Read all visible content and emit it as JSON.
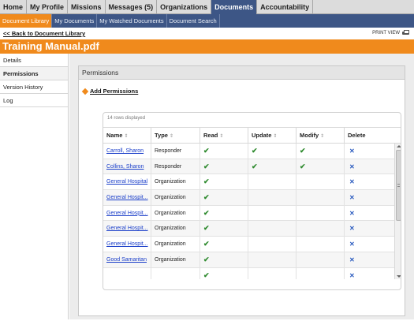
{
  "top_nav": [
    {
      "label": "Home",
      "active": false
    },
    {
      "label": "My Profile",
      "active": false
    },
    {
      "label": "Missions",
      "active": false
    },
    {
      "label": "Messages (5)",
      "active": false
    },
    {
      "label": "Organizations",
      "active": false
    },
    {
      "label": "Documents",
      "active": true
    },
    {
      "label": "Accountability",
      "active": false
    }
  ],
  "sub_nav": [
    {
      "label": "Document Library",
      "active": true
    },
    {
      "label": "My Documents",
      "active": false
    },
    {
      "label": "My Watched Documents",
      "active": false
    },
    {
      "label": "Document Search",
      "active": false
    }
  ],
  "back_link": "<< Back to Document Library",
  "print_view": "PRINT VIEW",
  "page_title": "Training Manual.pdf",
  "sidebar": {
    "items": [
      {
        "label": "Details",
        "active": false
      },
      {
        "label": "Permissions",
        "active": true
      },
      {
        "label": "Version History",
        "active": false
      },
      {
        "label": "Log",
        "active": false
      }
    ]
  },
  "permissions": {
    "header": "Permissions",
    "add_label": "Add Permissions",
    "rows_displayed": "14 rows displayed",
    "columns": [
      "Name",
      "Type",
      "Read",
      "Update",
      "Modify",
      "Delete"
    ],
    "rows": [
      {
        "name": "Carroll, Sharon",
        "type": "Responder",
        "read": true,
        "update": true,
        "modify": true,
        "delete": true
      },
      {
        "name": "Collins, Sharon",
        "type": "Responder",
        "read": true,
        "update": true,
        "modify": true,
        "delete": true
      },
      {
        "name": "General Hospital",
        "type": "Organization",
        "read": true,
        "update": false,
        "modify": false,
        "delete": true
      },
      {
        "name": "General Hospit...",
        "type": "Organization",
        "read": true,
        "update": false,
        "modify": false,
        "delete": true
      },
      {
        "name": "General Hospit...",
        "type": "Organization",
        "read": true,
        "update": false,
        "modify": false,
        "delete": true
      },
      {
        "name": "General Hospit...",
        "type": "Organization",
        "read": true,
        "update": false,
        "modify": false,
        "delete": true
      },
      {
        "name": "General Hospit...",
        "type": "Organization",
        "read": true,
        "update": false,
        "modify": false,
        "delete": true
      },
      {
        "name": "Good Samaritan",
        "type": "Organization",
        "read": true,
        "update": false,
        "modify": false,
        "delete": true
      },
      {
        "name": "",
        "type": "",
        "read": true,
        "update": false,
        "modify": false,
        "delete": true
      }
    ]
  },
  "icons": {
    "check": "✔",
    "delete": "✕",
    "sort": "⇕"
  },
  "colors": {
    "brand_orange": "#f08a1c",
    "nav_blue": "#3d5686",
    "check_green": "#2e8a2e",
    "link_blue": "#1a3ec9"
  }
}
